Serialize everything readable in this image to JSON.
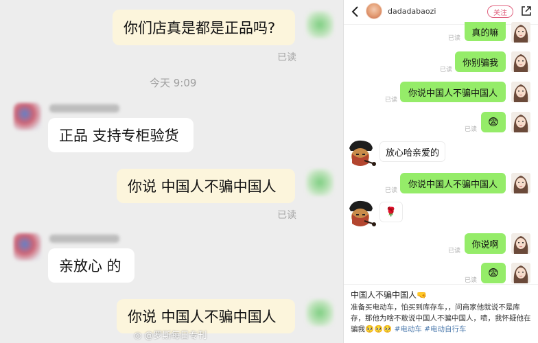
{
  "left": {
    "messages": [
      {
        "text": "你们店真是都是正品吗?",
        "read": "已读"
      },
      {
        "text": "正品 支持专柜验货"
      },
      {
        "text": "你说  中国人不骗中国人",
        "read": "已读"
      },
      {
        "text": "亲放心 的"
      },
      {
        "text": "你说  中国人不骗中国人"
      }
    ],
    "timestamp": "今天 9:09",
    "watermark": "@罗斯每日专刊"
  },
  "right": {
    "header": {
      "username": "dadadabaozi",
      "follow_label": "关注"
    },
    "read_label": "已读",
    "messages": [
      {
        "text": "真的嘛"
      },
      {
        "text": "你别骗我"
      },
      {
        "text": "你说中国人不骗中国人"
      },
      {
        "text": "😨"
      },
      {
        "text": "放心哈亲爱的"
      },
      {
        "text": "你说中国人不骗中国人"
      },
      {
        "text": "🌹"
      },
      {
        "text": "你说啊"
      },
      {
        "text": "😨"
      }
    ],
    "caption": {
      "title": "中国人不骗中国人🤜",
      "body": "准备买电动车，怕买到库存车，，问商家他就说不是库存，那他为啥不敢说中国人不骗中国人，啧，我怀疑他在骗我🥺🥺🥺",
      "tags": [
        "#电动车",
        "#电动自行车"
      ]
    }
  }
}
